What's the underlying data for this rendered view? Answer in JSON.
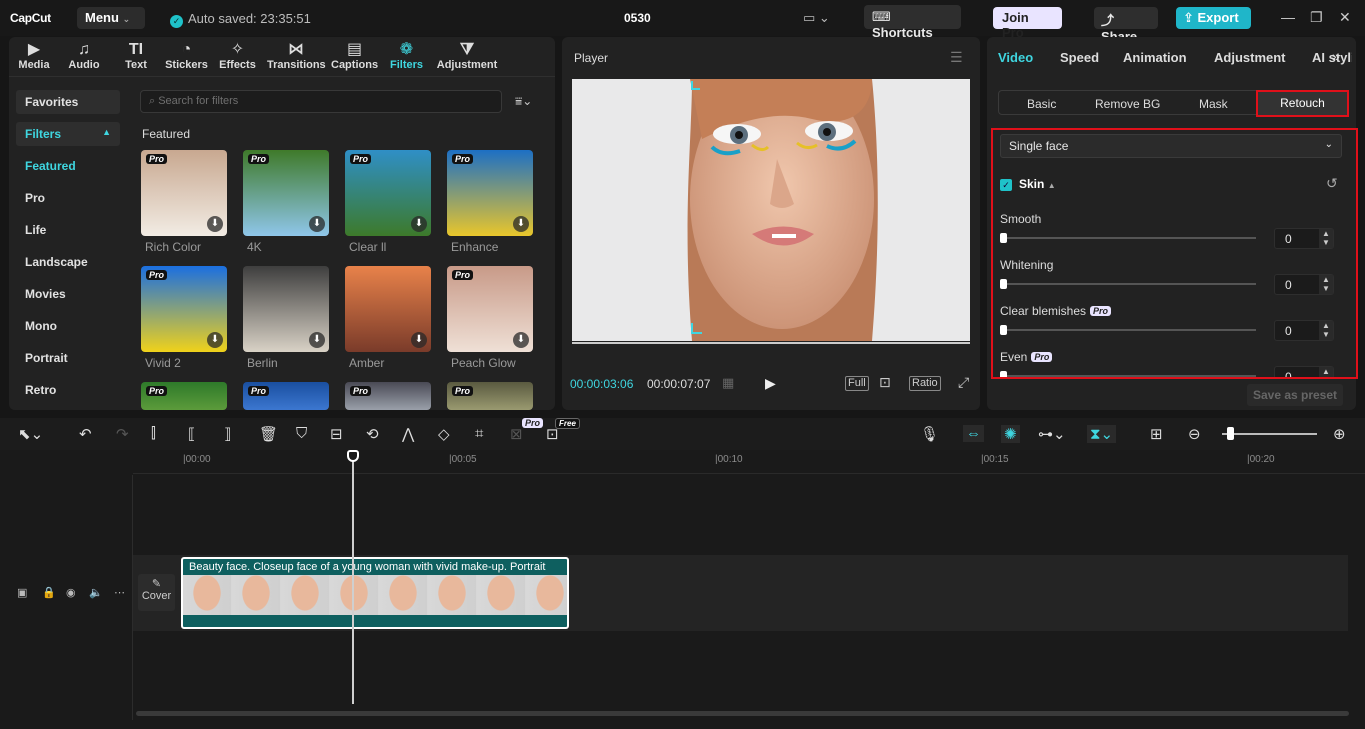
{
  "app": {
    "logo": "CapCut",
    "menu": "Menu",
    "autosave": "Auto saved: 23:35:51",
    "project_name": "0530"
  },
  "header": {
    "shortcuts": "Shortcuts",
    "join_pro": "Join Pro",
    "share": "Share",
    "export": "Export"
  },
  "media_tabs": [
    {
      "label": "Media",
      "icon": "media-icon"
    },
    {
      "label": "Audio",
      "icon": "audio-icon"
    },
    {
      "label": "Text",
      "icon": "text-icon"
    },
    {
      "label": "Stickers",
      "icon": "sticker-icon"
    },
    {
      "label": "Effects",
      "icon": "effects-icon"
    },
    {
      "label": "Transitions",
      "icon": "transitions-icon"
    },
    {
      "label": "Captions",
      "icon": "captions-icon"
    },
    {
      "label": "Filters",
      "icon": "filters-icon",
      "active": true
    },
    {
      "label": "Adjustment",
      "icon": "adjustment-icon"
    }
  ],
  "filters_nav": [
    "Favorites",
    "Filters",
    "Featured",
    "Pro",
    "Life",
    "Landscape",
    "Movies",
    "Mono",
    "Portrait",
    "Retro"
  ],
  "search": {
    "placeholder": "Search for filters"
  },
  "featured_heading": "Featured",
  "filters": [
    {
      "name": "Rich Color",
      "badge": "Pro",
      "colors": [
        "#c8a890",
        "#f2ece4"
      ]
    },
    {
      "name": "4K",
      "badge": "Pro",
      "colors": [
        "#3f7a2a",
        "#8fc6ea"
      ]
    },
    {
      "name": "Clear ll",
      "badge": "Pro",
      "colors": [
        "#2f8fc6",
        "#3d7a2a"
      ]
    },
    {
      "name": "Enhance",
      "badge": "Pro",
      "colors": [
        "#1d6fc4",
        "#e9c62b"
      ]
    },
    {
      "name": "Vivid 2",
      "badge": "Pro",
      "colors": [
        "#1b6fe0",
        "#f0d21a"
      ]
    },
    {
      "name": "Berlin",
      "badge": "",
      "colors": [
        "#3e3e3e",
        "#d9d2c6"
      ]
    },
    {
      "name": "Amber",
      "badge": "",
      "colors": [
        "#e8824a",
        "#7a3b2a"
      ]
    },
    {
      "name": "Peach Glow",
      "badge": "Pro",
      "colors": [
        "#c89a88",
        "#efe0d6"
      ]
    },
    {
      "name": "",
      "badge": "Pro",
      "colors": [
        "#2e7a2a",
        "#5c9b3b"
      ]
    },
    {
      "name": "",
      "badge": "Pro",
      "colors": [
        "#1a4fa0",
        "#3c77d0"
      ]
    },
    {
      "name": "",
      "badge": "Pro",
      "colors": [
        "#4a4a55",
        "#9aa0aa"
      ]
    },
    {
      "name": "",
      "badge": "Pro",
      "colors": [
        "#5a5a40",
        "#9a9a70"
      ]
    }
  ],
  "player": {
    "title": "Player",
    "current_time": "00:00:03:06",
    "total_time": "00:00:07:07",
    "full": "Full",
    "ratio": "Ratio"
  },
  "props": {
    "tabs": [
      "Video",
      "Speed",
      "Animation",
      "Adjustment",
      "AI styli"
    ],
    "subtabs": [
      "Basic",
      "Remove BG",
      "Mask",
      "Retouch"
    ],
    "face_mode": "Single face",
    "section": "Skin",
    "sliders": [
      {
        "label": "Smooth",
        "value": "0",
        "pro": ""
      },
      {
        "label": "Whitening",
        "value": "0",
        "pro": ""
      },
      {
        "label": "Clear blemishes",
        "value": "0",
        "pro": "Pro"
      },
      {
        "label": "Even",
        "value": "0",
        "pro": "Pro"
      }
    ],
    "save_preset": "Save as preset"
  },
  "toolbar": {
    "pro_badge": "Pro",
    "free_badge": "Free"
  },
  "timeline": {
    "ticks": [
      "|00:00",
      "|00:05",
      "|00:10",
      "|00:15",
      "|00:20"
    ],
    "clip_title": "Beauty face. Closeup face of a young woman with vivid make-up. Portrait",
    "cover": "Cover"
  }
}
